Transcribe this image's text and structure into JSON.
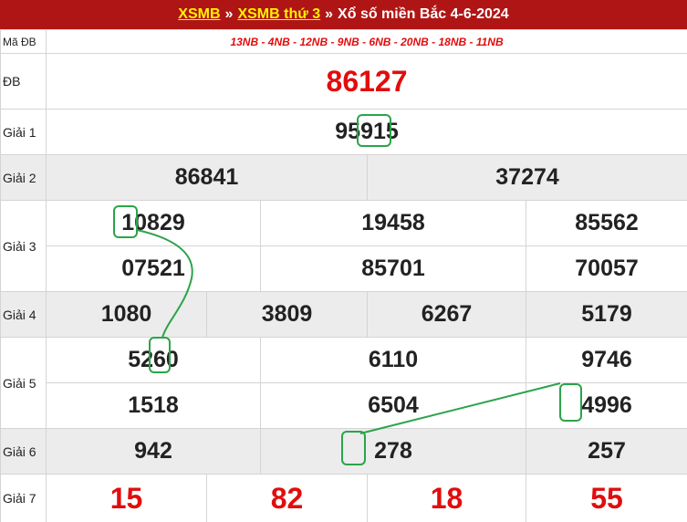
{
  "header": {
    "link1": "XSMB",
    "sep1": "»",
    "link2": "XSMB thứ 3",
    "sep2": "»",
    "title": "Xổ số miền Bắc 4-6-2024"
  },
  "code": {
    "label": "Mã ĐB",
    "value": "13NB - 4NB - 12NB - 9NB - 6NB - 20NB - 18NB - 11NB"
  },
  "prizes": {
    "db": {
      "label": "ĐB",
      "value": "86127"
    },
    "g1": {
      "label": "Giải 1",
      "value": "95915"
    },
    "g2": {
      "label": "Giải 2",
      "values": [
        "86841",
        "37274"
      ]
    },
    "g3": {
      "label": "Giải 3",
      "values": [
        "10829",
        "19458",
        "85562",
        "07521",
        "85701",
        "70057"
      ]
    },
    "g4": {
      "label": "Giải 4",
      "values": [
        "1080",
        "3809",
        "6267",
        "5179"
      ]
    },
    "g5": {
      "label": "Giải 5",
      "values": [
        "5260",
        "6110",
        "9746",
        "1518",
        "6504",
        "4996"
      ]
    },
    "g6": {
      "label": "Giải 6",
      "values": [
        "942",
        "278",
        "257"
      ]
    },
    "g7": {
      "label": "Giải 7",
      "values": [
        "15",
        "82",
        "18",
        "55"
      ]
    }
  },
  "colors": {
    "header_bg": "#b01515",
    "link": "#fff200",
    "accent_red": "#e10d0d",
    "highlight_green": "#2aa44a",
    "row_gray": "#ececec"
  }
}
